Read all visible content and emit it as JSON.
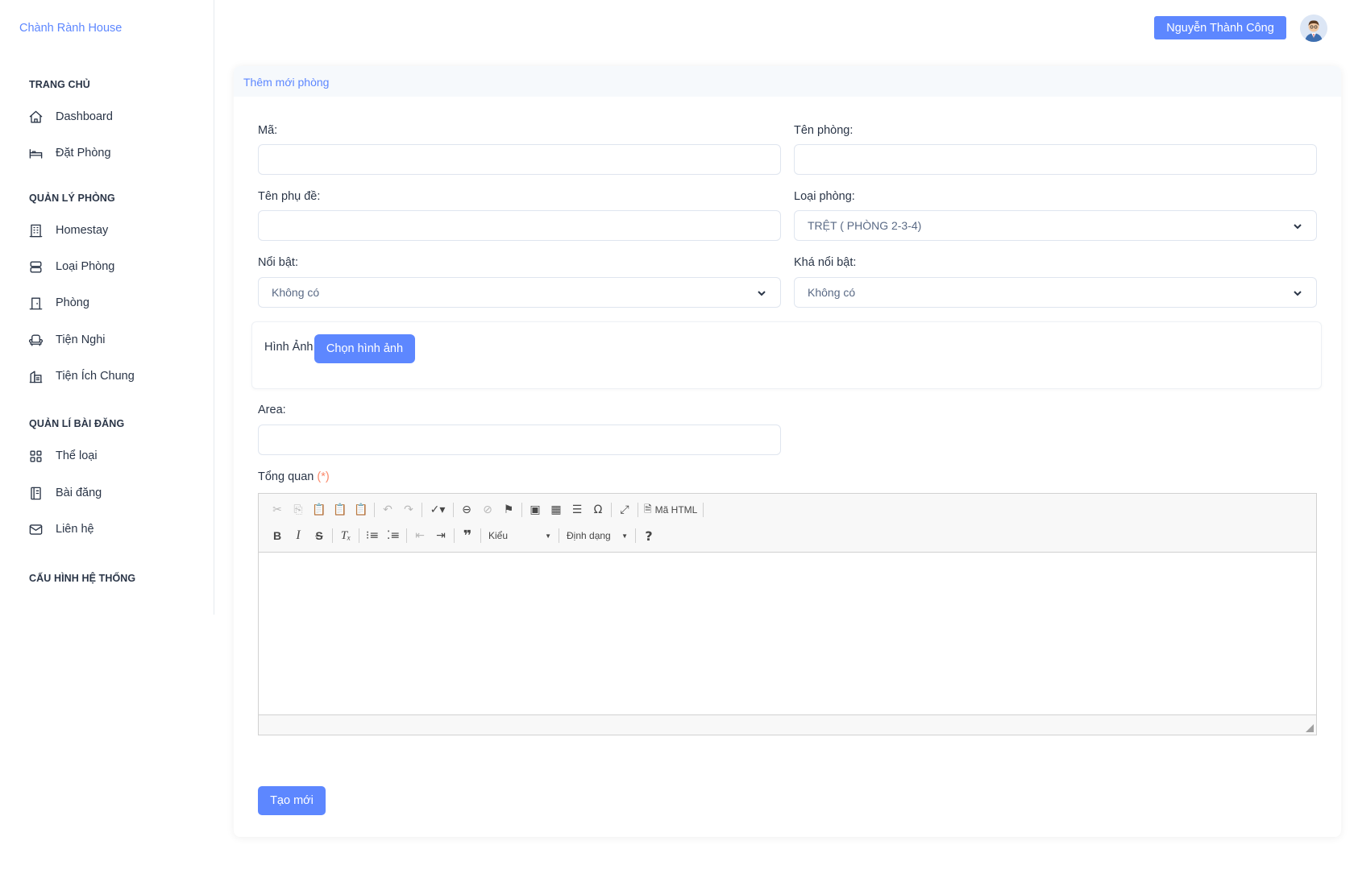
{
  "app": {
    "brand": "Chành Rành House"
  },
  "header": {
    "user_name": "Nguyễn Thành Công"
  },
  "sidebar": {
    "sections": [
      {
        "title": "TRANG CHỦ",
        "items": [
          {
            "label": "Dashboard",
            "icon": "home-icon"
          },
          {
            "label": "Đặt Phòng",
            "icon": "bed-icon"
          }
        ]
      },
      {
        "title": "QUẢN LÝ PHÒNG",
        "items": [
          {
            "label": "Homestay",
            "icon": "building-icon"
          },
          {
            "label": "Loại Phòng",
            "icon": "server-icon"
          },
          {
            "label": "Phòng",
            "icon": "door-icon"
          },
          {
            "label": "Tiện Nghi",
            "icon": "armchair-icon"
          },
          {
            "label": "Tiện Ích Chung",
            "icon": "buildings-icon"
          }
        ]
      },
      {
        "title": "QUẢN LÍ BÀI ĐĂNG",
        "items": [
          {
            "label": "Thể loại",
            "icon": "category-icon"
          },
          {
            "label": "Bài đăng",
            "icon": "notebook-icon"
          },
          {
            "label": "Liên hệ",
            "icon": "mail-icon"
          }
        ]
      },
      {
        "title": "CẤU HÌNH HỆ THỐNG",
        "items": []
      }
    ]
  },
  "form": {
    "title": "Thêm mới phòng",
    "ma": {
      "label": "Mã:",
      "value": ""
    },
    "ten_phong": {
      "label": "Tên phòng:",
      "value": ""
    },
    "ten_phu_de": {
      "label": "Tên phụ đề:",
      "value": ""
    },
    "loai_phong": {
      "label": "Loại phòng:",
      "value": "TRỆT ( PHÒNG 2-3-4)"
    },
    "noi_bat": {
      "label": "Nổi bật:",
      "value": "Không có"
    },
    "kha_noi_bat": {
      "label": "Khá nổi bật:",
      "value": "Không có"
    },
    "hinh_anh": {
      "label": "Hình Ảnh",
      "button": "Chọn hình ảnh"
    },
    "area": {
      "label": "Area:",
      "value": ""
    },
    "tong_quan": {
      "label": "Tổng quan",
      "required": "(*)"
    },
    "submit": "Tạo mới"
  },
  "editor": {
    "source_label": "Mã HTML",
    "style_combo": "Kiểu",
    "format_combo": "Định dạng",
    "help": "?"
  },
  "colors": {
    "primary": "#5d87ff",
    "text": "#2a3547",
    "required": "#fa896b",
    "border": "#dfe5ef"
  }
}
